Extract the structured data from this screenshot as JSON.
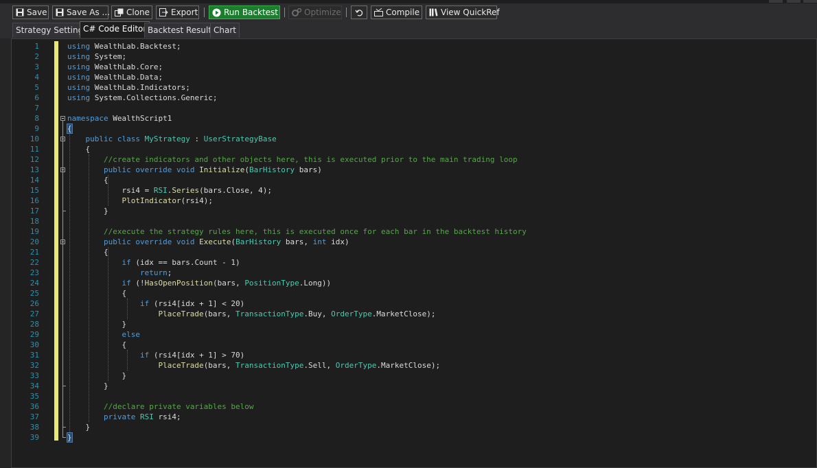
{
  "toolbar": {
    "save": "Save",
    "save_as": "Save As ...",
    "clone": "Clone",
    "export": "Export",
    "run_backtest": "Run Backtest",
    "optimize": "Optimize",
    "compile": "Compile",
    "view_quickref": "View QuickRef"
  },
  "tabs": [
    "Strategy Settings",
    "C# Code Editor",
    "Backtest Results",
    "Chart"
  ],
  "active_tab": "C# Code Editor",
  "colors": {
    "keyword": "#569cd6",
    "type": "#4ec9b0",
    "comment": "#57a64a",
    "method": "#dcdcaa",
    "text": "#dcdcdc",
    "line_number": "#2b91af",
    "change_bar": "#e8e874",
    "run_button": "#1d7d2e"
  },
  "editor": {
    "line_numbers": [
      "1",
      "2",
      "3",
      "4",
      "5",
      "6",
      "7",
      "8",
      "9",
      "10",
      "11",
      "12",
      "13",
      "14",
      "15",
      "16",
      "17",
      "18",
      "19",
      "20",
      "21",
      "22",
      "23",
      "24",
      "25",
      "26",
      "27",
      "28",
      "29",
      "30",
      "31",
      "32",
      "33",
      "34",
      "35",
      "36",
      "37",
      "38",
      "39"
    ],
    "lines": [
      "using WealthLab.Backtest;",
      "using System;",
      "using WealthLab.Core;",
      "using WealthLab.Data;",
      "using WealthLab.Indicators;",
      "using System.Collections.Generic;",
      "",
      "namespace WealthScript1",
      "{",
      "    public class MyStrategy : UserStrategyBase",
      "    {",
      "        //create indicators and other objects here, this is executed prior to the main trading loop",
      "        public override void Initialize(BarHistory bars)",
      "        {",
      "            rsi4 = RSI.Series(bars.Close, 4);",
      "            PlotIndicator(rsi4);",
      "        }",
      "",
      "        //execute the strategy rules here, this is executed once for each bar in the backtest history",
      "        public override void Execute(BarHistory bars, int idx)",
      "        {",
      "            if (idx == bars.Count - 1)",
      "                return;",
      "            if (!HasOpenPosition(bars, PositionType.Long))",
      "            {",
      "                if (rsi4[idx + 1] < 20)",
      "                    PlaceTrade(bars, TransactionType.Buy, OrderType.MarketClose);",
      "            }",
      "            else",
      "            {",
      "                if (rsi4[idx + 1] > 70)",
      "                    PlaceTrade(bars, TransactionType.Sell, OrderType.MarketClose);",
      "            }",
      "        }",
      "",
      "        //declare private variables below",
      "        private RSI rsi4;",
      "    }",
      "}"
    ]
  }
}
